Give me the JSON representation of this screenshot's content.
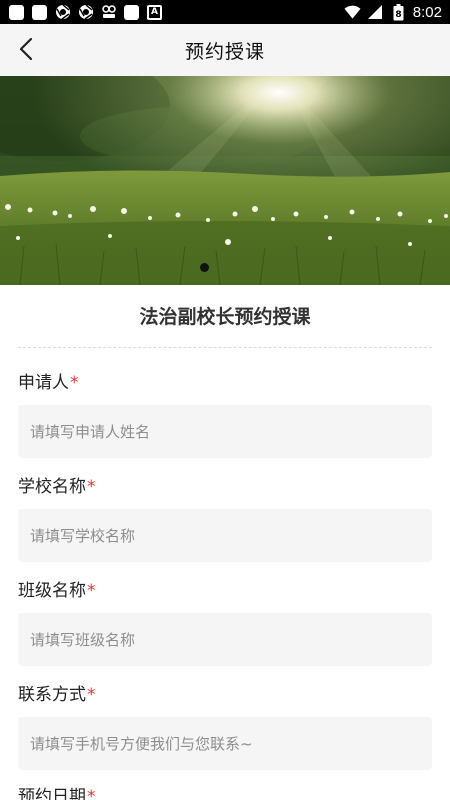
{
  "status_bar": {
    "time": "8:02",
    "battery_level": "8",
    "left_icons": [
      "app-icon",
      "app-icon",
      "chrome-icon",
      "chrome-icon",
      "ai-app-icon",
      "app-icon",
      "a-icon"
    ],
    "right_icons": [
      "wifi-icon",
      "signal-icon",
      "battery-icon"
    ]
  },
  "nav": {
    "title": "预约授课",
    "back_icon": "chevron-left-icon"
  },
  "banner": {
    "slide_count": 1,
    "active_index": 0
  },
  "form": {
    "title": "法治副校长预约授课",
    "required_mark": "*",
    "fields": [
      {
        "label": "申请人",
        "placeholder": "请填写申请人姓名",
        "value": ""
      },
      {
        "label": "学校名称",
        "placeholder": "请填写学校名称",
        "value": ""
      },
      {
        "label": "班级名称",
        "placeholder": "请填写班级名称",
        "value": ""
      },
      {
        "label": "联系方式",
        "placeholder": "请填写手机号方便我们与您联系~",
        "value": ""
      },
      {
        "label": "预约日期",
        "placeholder": "",
        "value": ""
      }
    ]
  },
  "colors": {
    "required": "#e53935",
    "input_bg": "#f5f5f5",
    "nav_bg": "#f5f5f5"
  }
}
